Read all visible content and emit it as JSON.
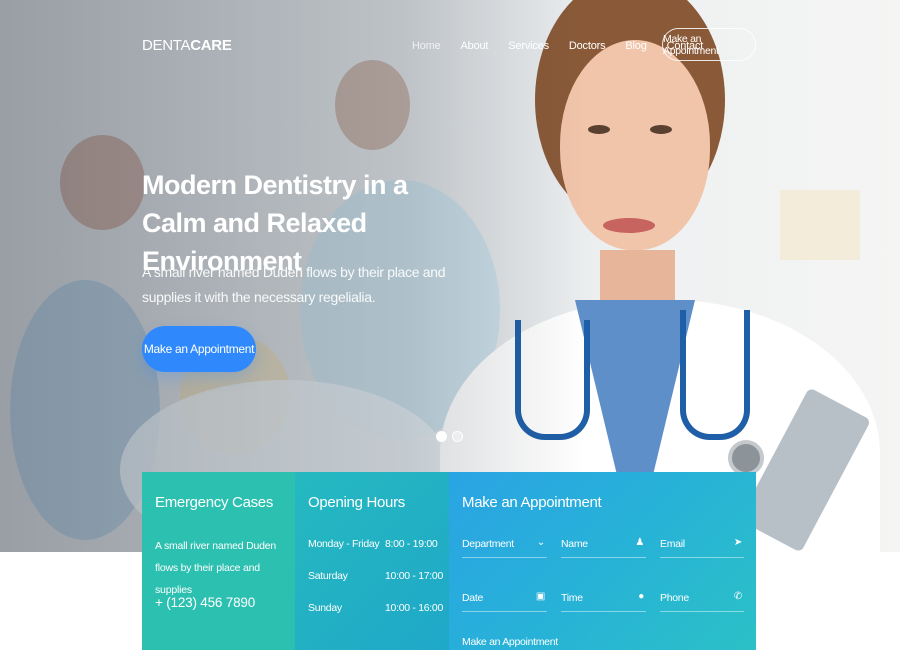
{
  "nav": {
    "logo_light": "DENTA",
    "logo_bold": "CARE",
    "links": [
      "Home",
      "About",
      "Services",
      "Doctors",
      "Blog",
      "Contact"
    ],
    "active_link": "Home",
    "cta": "Make an Appointment"
  },
  "hero": {
    "title": "Modern Dentistry in a Calm and Relaxed Environment",
    "subtitle": "A small river named Duden flows by their place and supplies it with the necessary regelialia.",
    "button": "Make an Appointment",
    "slides": 2,
    "active_slide": 1
  },
  "emergency": {
    "title": "Emergency Cases",
    "text": "A small river named Duden flows by their place and supplies",
    "phone": "+ (123) 456 7890"
  },
  "hours": {
    "title": "Opening Hours",
    "rows": [
      {
        "day": "Monday - Friday",
        "time": "8:00 - 19:00"
      },
      {
        "day": "Saturday",
        "time": "10:00 - 17:00"
      },
      {
        "day": "Sunday",
        "time": "10:00 - 16:00"
      }
    ]
  },
  "appointment": {
    "title": "Make an Appointment",
    "fields": [
      {
        "label": "Department",
        "icon": "chevron-down-icon",
        "glyph": "⌄"
      },
      {
        "label": "Name",
        "icon": "user-icon",
        "glyph": "♟"
      },
      {
        "label": "Email",
        "icon": "paper-plane-icon",
        "glyph": "➤"
      },
      {
        "label": "Date",
        "icon": "calendar-icon",
        "glyph": "▣"
      },
      {
        "label": "Time",
        "icon": "clock-icon",
        "glyph": "●"
      },
      {
        "label": "Phone",
        "icon": "phone-icon",
        "glyph": "✆"
      }
    ],
    "submit": "Make an Appointment"
  },
  "colors": {
    "primary_button": "#2f89fc",
    "emergency_bg": "#2cc0b0",
    "hours_bg": "#1fa8c8",
    "appointment_bg": "#2aa4e4"
  }
}
